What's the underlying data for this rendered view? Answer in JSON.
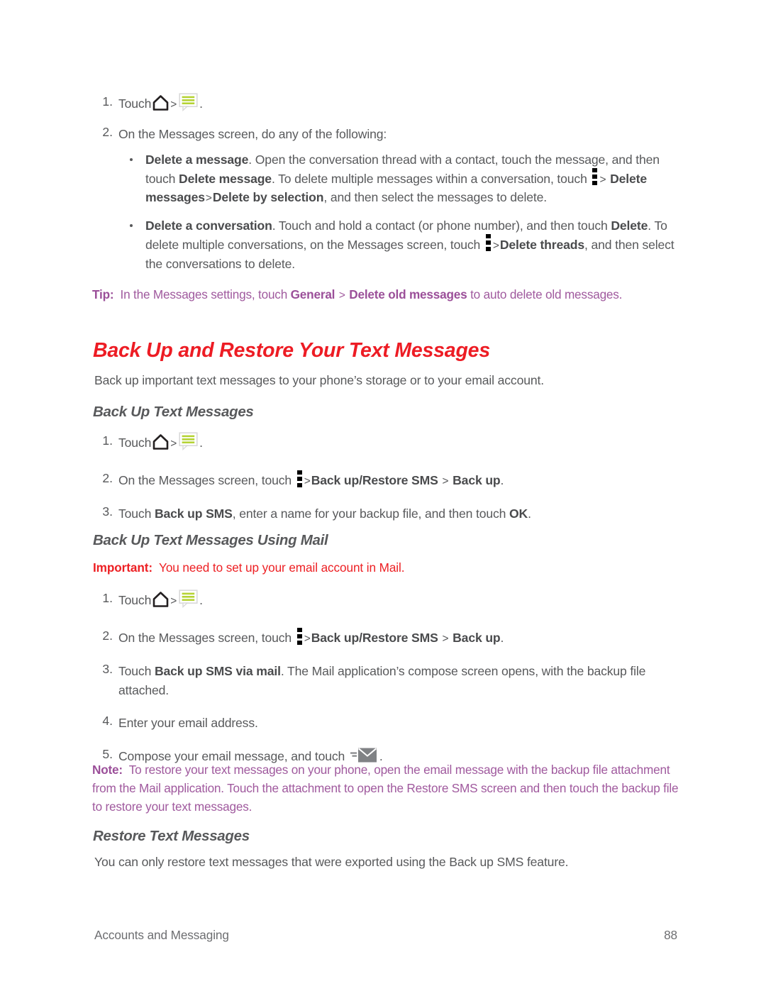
{
  "document": {
    "footer_left": "Accounts and Messaging",
    "footer_page": "88"
  },
  "colors": {
    "section_heading": "#ed1c24",
    "sub_heading": "#58595b",
    "body": "#58595b",
    "tip": "#a05a9e",
    "note": "#a05a9e",
    "important": "#ed2024",
    "menu_icon": "#000000",
    "message_icon_lines": "#b5d334"
  },
  "icons": {
    "home": "home-icon",
    "messaging": "messaging-icon",
    "menu": "overflow-menu-icon",
    "send": "send-mail-icon",
    "separator": ">"
  },
  "top_procedure": {
    "step1": {
      "number": "1.",
      "prefix": "Touch",
      "suffix": "."
    },
    "step2": {
      "number": "2.",
      "text": "On the Messages screen, do any of the following:"
    },
    "bullets": [
      {
        "lead": "Delete a message",
        "part1": ". Open the conversation thread with a contact, touch the message, and then touch ",
        "bold1": "Delete message",
        "part2": ". To delete multiple messages within a conversation, touch ",
        "bold2": "Delete messages",
        "bold3": "Delete by selection",
        "part3": ", and then select the messages to delete."
      },
      {
        "lead": "Delete a conversation",
        "part1": ". Touch and hold a contact (or phone number), and then touch ",
        "bold1": "Delete",
        "part2": ". To delete multiple conversations, on the Messages screen, touch ",
        "bold2": "Delete threads",
        "part3": ", and then select the conversations to delete."
      }
    ],
    "tip": {
      "label": "Tip:",
      "part1": "In the Messages settings, touch ",
      "bold1": "General",
      "bold2": "Delete old messages",
      "part2": " to auto delete old messages."
    }
  },
  "section": {
    "title": "Back Up and Restore Your Text Messages",
    "intro": "Back up important text messages to your phone’s storage or to your email account."
  },
  "backup": {
    "heading": "Back Up Text Messages",
    "step1": {
      "number": "1.",
      "prefix": "Touch",
      "suffix": "."
    },
    "step2": {
      "number": "2.",
      "part1": "On the Messages screen, touch ",
      "bold1": "Back up/Restore SMS",
      "bold2": "Back up",
      "part2": "."
    },
    "step3": {
      "number": "3.",
      "part1": "Touch ",
      "bold1": "Back up SMS",
      "part2": ", enter a name for your backup file, and then touch ",
      "bold2": "OK",
      "part3": "."
    }
  },
  "backup_mail": {
    "heading": "Back Up Text Messages Using Mail",
    "important": {
      "label": "Important:",
      "text": "You need to set up your email account in Mail."
    },
    "step1": {
      "number": "1.",
      "prefix": "Touch",
      "suffix": "."
    },
    "step2": {
      "number": "2.",
      "part1": "On the Messages screen, touch ",
      "bold1": "Back up/Restore SMS",
      "bold2": "Back up",
      "part2": "."
    },
    "step3": {
      "number": "3.",
      "part1": "Touch ",
      "bold1": "Back up SMS via mail",
      "part2": ". The Mail application’s compose screen opens, with the backup file attached."
    },
    "step4": {
      "number": "4.",
      "text": "Enter your email address."
    },
    "step5": {
      "number": "5.",
      "part1": "Compose your email message, and touch ",
      "part2": "."
    },
    "note": {
      "label": "Note:",
      "text": "To restore your text messages on your phone, open the email message with the backup file attachment from the Mail application. Touch the attachment to open the Restore SMS screen and then touch the backup file to restore your text messages."
    }
  },
  "restore": {
    "heading": "Restore Text Messages",
    "text": "You can only restore text messages that were exported using the Back up SMS feature."
  }
}
